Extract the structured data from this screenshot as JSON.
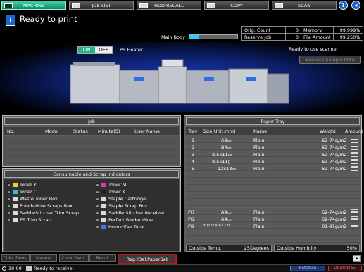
{
  "tabs": [
    {
      "label": "MACHINE",
      "active": true,
      "icon": "machine-icon"
    },
    {
      "label": "JOB LIST",
      "active": false,
      "icon": "job-list-icon"
    },
    {
      "label": "HDD RECALL",
      "active": false,
      "icon": "hdd-icon"
    },
    {
      "label": "COPY",
      "active": false,
      "icon": "copy-icon"
    },
    {
      "label": "SCAN",
      "active": false,
      "icon": "scan-icon"
    }
  ],
  "header": {
    "info_icon": "i",
    "status": "Ready to print",
    "main_body": "Main Body"
  },
  "counters": {
    "orig_count_label": "Orig. Count",
    "orig_count_value": "0",
    "memory_label": "Memory",
    "memory_value": "99.999%",
    "reserve_job_label": "Reserve Job",
    "reserve_job_value": "0",
    "file_amount_label": "File Amount",
    "file_amount_value": "99.250%"
  },
  "heater": {
    "on": "ON",
    "off": "OFF",
    "label": "PB Heater"
  },
  "scanner_status": "Ready to use scanner",
  "execute_sample_print": "Execute Sample Print",
  "job": {
    "title": "Job",
    "columns": [
      "No.",
      "Mode",
      "Status",
      "Minute(S)",
      "User Name"
    ]
  },
  "consumables": {
    "title": "Consumable and Scrap Indicators",
    "left": [
      "Toner Y",
      "Toner C",
      "Waste Toner Box",
      "Punch-Hole Scraps Box",
      "SaddleStitcher Trim Scrap",
      "PB Trim Scrap"
    ],
    "right": [
      "Toner M",
      "Toner K",
      "Staple Cartridge",
      "Staple Scrap Box",
      "Saddle Stitcher Receiver",
      "Perfect Binder Glue",
      "Humidifier Tank"
    ]
  },
  "paper_tray": {
    "title": "Paper Tray",
    "columns": [
      "Tray",
      "Size(Unit:mm)",
      "Name",
      "Weight",
      "Amount"
    ],
    "rows": [
      {
        "tray": "1",
        "size": "A3▭",
        "name": "Plain",
        "weight": "62-74g/m2"
      },
      {
        "tray": "2",
        "size": "B4▭",
        "name": "Plain",
        "weight": "62-74g/m2"
      },
      {
        "tray": "3",
        "size": "8.5x11▭",
        "name": "Plain",
        "weight": "62-74g/m2"
      },
      {
        "tray": "4",
        "size": "8.5x11▯",
        "name": "Plain",
        "weight": "62-74g/m2"
      },
      {
        "tray": "5",
        "size": "12x18▭",
        "name": "Plain",
        "weight": "62-74g/m2"
      }
    ],
    "pi_rows": [
      {
        "tray": "PI1",
        "size": "A4▭",
        "name": "Plain",
        "weight": "62-74g/m2"
      },
      {
        "tray": "PI2",
        "size": "A4▭",
        "name": "Plain",
        "weight": "62-74g/m2"
      },
      {
        "tray": "PB",
        "size": "307.0 x 472.0",
        "name": "Plain",
        "weight": "81-91g/m2"
      }
    ],
    "outside_temp_label": "Outside Temp.",
    "outside_temp_value": "25Degrees",
    "outside_humidity_label": "Outside Humidity",
    "outside_humidity_value": "50%"
  },
  "footer": {
    "buttons": [
      "Color Dens.",
      "Manual",
      "Color Dens.",
      "Result"
    ],
    "reg_button": "Reg./Del.PaperSet",
    "time": "10:00",
    "status": "Ready to receive",
    "rotation": "Rotation",
    "drum": "Drum/Dev."
  },
  "colors": {
    "accent": "#1fb48a",
    "highlight_red": "#d01010",
    "panel": "#5c5c5c"
  }
}
